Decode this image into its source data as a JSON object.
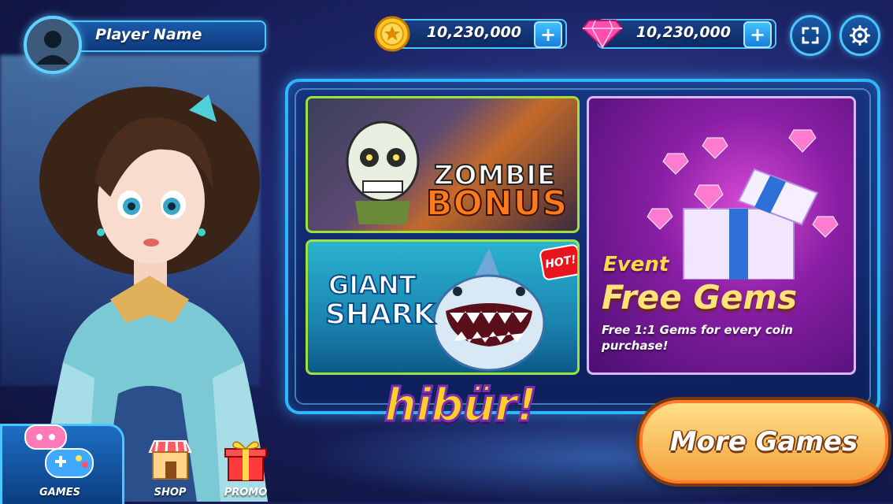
{
  "player": {
    "name": "Player Name"
  },
  "currency": {
    "coins": {
      "value": "10,230,000",
      "plus_label": "+"
    },
    "gems": {
      "value": "10,230,000",
      "plus_label": "+"
    }
  },
  "games": {
    "zombie": {
      "title_line1": "ZOMBIE",
      "title_line2": "BONUS"
    },
    "shark": {
      "title_line1": "GIANT",
      "title_line2": "SHARK",
      "badge": "HOT!"
    }
  },
  "event": {
    "label": "Event",
    "title": "Free Gems",
    "description": "Free 1:1 Gems for every coin purchase!"
  },
  "logo": {
    "text": "hibür!"
  },
  "more_games": {
    "label": "More Games"
  },
  "nav": {
    "items": [
      {
        "label": "GAMES",
        "icon": "gamepad-icon",
        "active": true
      },
      {
        "label": "SHOP",
        "icon": "shop-icon",
        "active": false
      },
      {
        "label": "PROMO",
        "icon": "gift-icon",
        "active": false
      }
    ]
  },
  "colors": {
    "accent": "#2fb6ff",
    "coin": "#ffc629",
    "gem": "#ff4fae",
    "card_border": "#9be33a",
    "more_games": "#f3a13a"
  }
}
